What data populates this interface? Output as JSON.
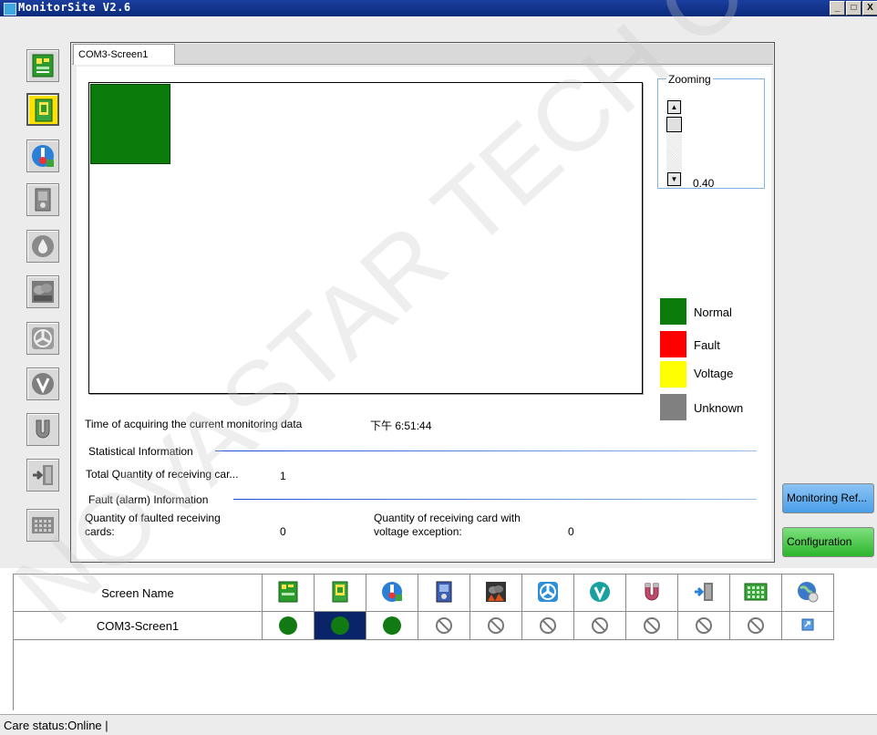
{
  "window": {
    "title": "MonitorSite V2.6",
    "min_label": "_",
    "max_label": "□",
    "close_label": "X"
  },
  "toolbar": {
    "items": [
      {
        "icon": "receiving-card-icon",
        "selected": false
      },
      {
        "icon": "monitoring-card-icon",
        "selected": true
      },
      {
        "icon": "temperature-icon",
        "selected": false
      },
      {
        "icon": "hub-card-icon",
        "selected": false
      },
      {
        "icon": "humidity-icon",
        "selected": false
      },
      {
        "icon": "smoke-icon",
        "selected": false
      },
      {
        "icon": "fan-icon",
        "selected": false
      },
      {
        "icon": "voltage-icon",
        "selected": false
      },
      {
        "icon": "magnet-icon",
        "selected": false
      },
      {
        "icon": "door-icon",
        "selected": false
      },
      {
        "icon": "module-icon",
        "selected": false
      }
    ]
  },
  "tab": {
    "label": "COM3-Screen1"
  },
  "zooming": {
    "label": "Zooming",
    "value": "0.40",
    "up": "▲",
    "down": "▼"
  },
  "legend": [
    {
      "label": "Normal",
      "color": "#0b7c0b"
    },
    {
      "label": "Fault",
      "color": "#ff0000"
    },
    {
      "label": "Voltage",
      "color": "#ffff00"
    },
    {
      "label": "Unknown",
      "color": "#808080"
    }
  ],
  "info": {
    "time_label": "Time of acquiring the current monitoring data",
    "time_value": "下午 6:51:44",
    "stat_header": "Statistical Information",
    "total_label": "Total Quantity of receiving car...",
    "total_value": "1",
    "fault_header": "Fault (alarm) Information",
    "faulted_label_1": "Quantity of faulted receiving",
    "faulted_label_2": "cards:",
    "faulted_value": "0",
    "voltage_label_1": "Quantity of receiving card with",
    "voltage_label_2": "voltage exception:",
    "voltage_value": "0"
  },
  "buttons": {
    "monitoring_refresh": "Monitoring Ref...",
    "configuration": "Configuration"
  },
  "table": {
    "header_name": "Screen Name",
    "columns": [
      "receiving-card-icon",
      "monitoring-card-icon",
      "temperature-icon",
      "hub-card-icon",
      "smoke-icon",
      "fan-icon",
      "voltage-icon",
      "magnet-icon",
      "door-icon",
      "module-icon",
      "refresh-globe-icon"
    ],
    "rows": [
      {
        "name": "COM3-Screen1",
        "status": [
          "ok",
          "ok",
          "ok",
          "na",
          "na",
          "na",
          "na",
          "na",
          "na",
          "na",
          "link"
        ]
      }
    ]
  },
  "status": {
    "text": "Care status:Online  |"
  },
  "watermark": "NOVASTAR TECH CO."
}
